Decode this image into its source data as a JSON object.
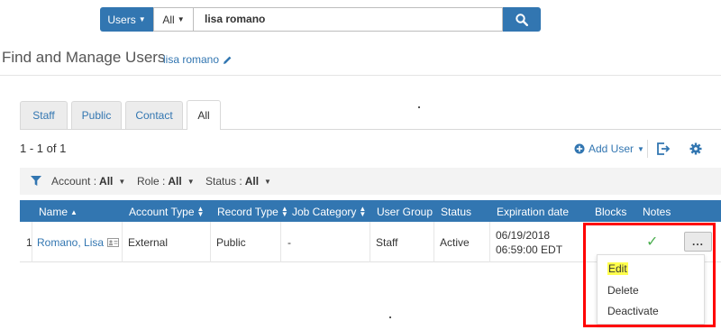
{
  "search": {
    "scope_label": "Users",
    "filter_label": "All",
    "query": "lisa romano"
  },
  "page": {
    "title": "Find and Manage Users",
    "breadcrumb": "lisa romano"
  },
  "tabs": [
    {
      "label": "Staff"
    },
    {
      "label": "Public"
    },
    {
      "label": "Contact"
    },
    {
      "label": "All"
    }
  ],
  "results": {
    "count": "1 - 1 of 1",
    "add_user_label": "Add User"
  },
  "filters": [
    {
      "label": "Account :",
      "value": "All"
    },
    {
      "label": "Role :",
      "value": "All"
    },
    {
      "label": "Status :",
      "value": "All"
    }
  ],
  "table": {
    "columns": [
      "Name",
      "Account Type",
      "Record Type",
      "Job Category",
      "User Group",
      "Status",
      "Expiration date",
      "Blocks",
      "Notes"
    ],
    "rows": [
      {
        "index": "1",
        "name": "Romano, Lisa",
        "account_type": "External",
        "record_type": "Public",
        "job_category": "-",
        "user_group": "Staff",
        "status": "Active",
        "expiration_date": "06/19/2018",
        "expiration_time": "06:59:00 EDT",
        "blocks": "",
        "notes_check": "✓"
      }
    ]
  },
  "row_menu": {
    "more_label": "...",
    "items": [
      {
        "label": "Edit"
      },
      {
        "label": "Delete"
      },
      {
        "label": "Deactivate"
      }
    ]
  },
  "colors": {
    "primary": "#3276b1",
    "highlight": "#ffff4d",
    "annotation": "#ff0000",
    "check": "#4caf50"
  }
}
